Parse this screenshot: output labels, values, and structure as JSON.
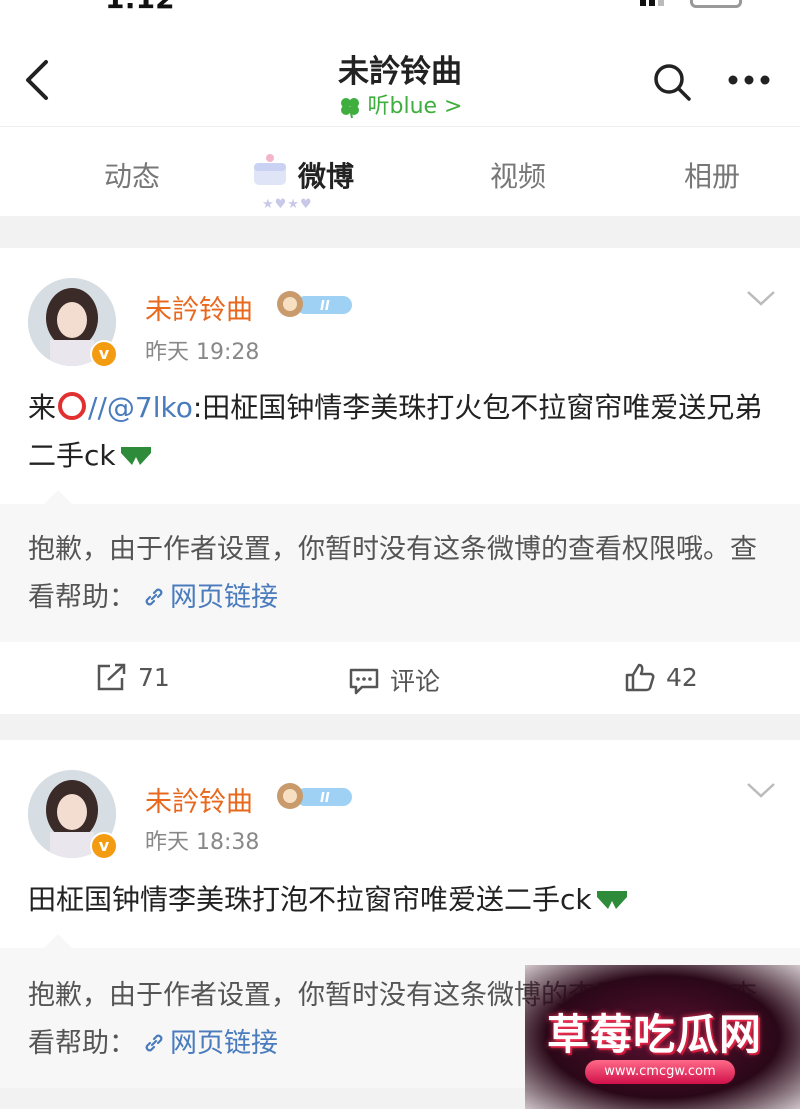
{
  "header": {
    "title": "未訡铃曲",
    "subtitle": "听blue >"
  },
  "tabs": [
    {
      "label": "动态"
    },
    {
      "label": "微博"
    },
    {
      "label": "视频"
    },
    {
      "label": "相册"
    }
  ],
  "posts": [
    {
      "author": "未訡铃曲",
      "time": "昨天 19:28",
      "text_before": "来",
      "mention": "//@7lko",
      "text_after": ":田柾国钟情李美珠打火包不拉窗帘唯爱送兄弟二手ck",
      "notice": "抱歉，由于作者设置，你暂时没有这条微博的查看权限哦。查看帮助：",
      "link": "网页链接",
      "reposts": "71",
      "comment_label": "评论",
      "likes": "42"
    },
    {
      "author": "未訡铃曲",
      "time": "昨天 18:38",
      "text": "田柾国钟情李美珠打泡不拉窗帘唯爱送二手ck",
      "notice": "抱歉，由于作者设置，你暂时没有这条微博的查看权限哦。查看帮助：",
      "link": "网页链接"
    }
  ],
  "watermark": {
    "title": "草莓吃瓜网",
    "url": "www.cmcgw.com"
  },
  "colors": {
    "author": "#e8681e",
    "link": "#4a7bbd",
    "accent_green": "#3fae3f"
  }
}
